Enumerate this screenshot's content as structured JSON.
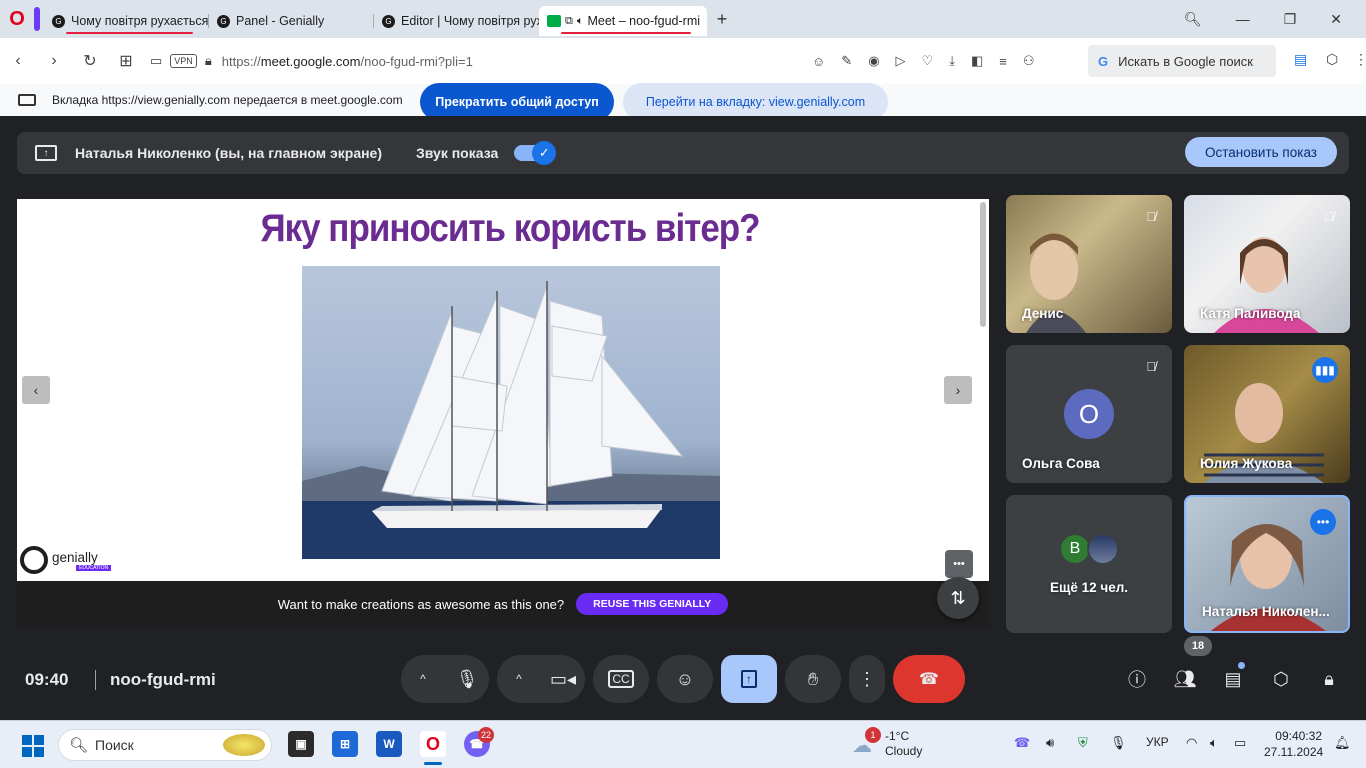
{
  "browser": {
    "tabs": [
      {
        "title": "Чому повітря рухається?",
        "active": false
      },
      {
        "title": "Panel - Genially",
        "active": false
      },
      {
        "title": "Editor | Чому повітря рухається?",
        "active": false
      },
      {
        "title": "Meet – noo-fgud-rmi",
        "active": true
      }
    ],
    "new_tab": "+",
    "url_prefix": "https://",
    "url_host": "meet.google.com",
    "url_path": "/noo-fgud-rmi?pli=1",
    "vpn": "VPN",
    "search_box": "Искать в Google поиск"
  },
  "share_banner": {
    "text": "Вкладка https://view.genially.com передается в meet.google.com",
    "stop_label": "Прекратить общий доступ",
    "goto_label": "Перейти на вкладку: view.genially.com"
  },
  "presentation_bar": {
    "presenter": "Наталья Николенко (вы, на главном экране)",
    "sound_label": "Звук показа",
    "stop_label": "Остановить показ"
  },
  "slide": {
    "title": "Яку приносить користь вітер?",
    "brand": "genially",
    "brand_sub": "EDUCATION",
    "cta_text": "Want to make creations as awesome as this one?",
    "cta_button": "REUSE THIS GENIALLY"
  },
  "participants": [
    {
      "name": "Денис",
      "muted": true
    },
    {
      "name": "Катя Паливода",
      "muted": true
    },
    {
      "name": "Ольга Сова",
      "initial": "О",
      "muted": true
    },
    {
      "name": "Юлия Жукова",
      "speaking": true
    },
    {
      "name": "Ещё 12 чел.",
      "initial": "В"
    },
    {
      "name": "Наталья Николен...",
      "self": true
    }
  ],
  "controls": {
    "time": "09:40",
    "meeting_code": "noo-fgud-rmi",
    "people_count": "18"
  },
  "taskbar": {
    "search": "Поиск",
    "viber_badge": "22",
    "weather_badge": "1",
    "temp": "-1°C",
    "weather": "Cloudy",
    "lang": "УКР",
    "time": "09:40:32",
    "date": "27.11.2024"
  },
  "colors": {
    "accent": "#1a73e8",
    "end_call": "#dc362e",
    "slide_title": "#6a2c91",
    "reuse_button": "#6a2cf5"
  }
}
